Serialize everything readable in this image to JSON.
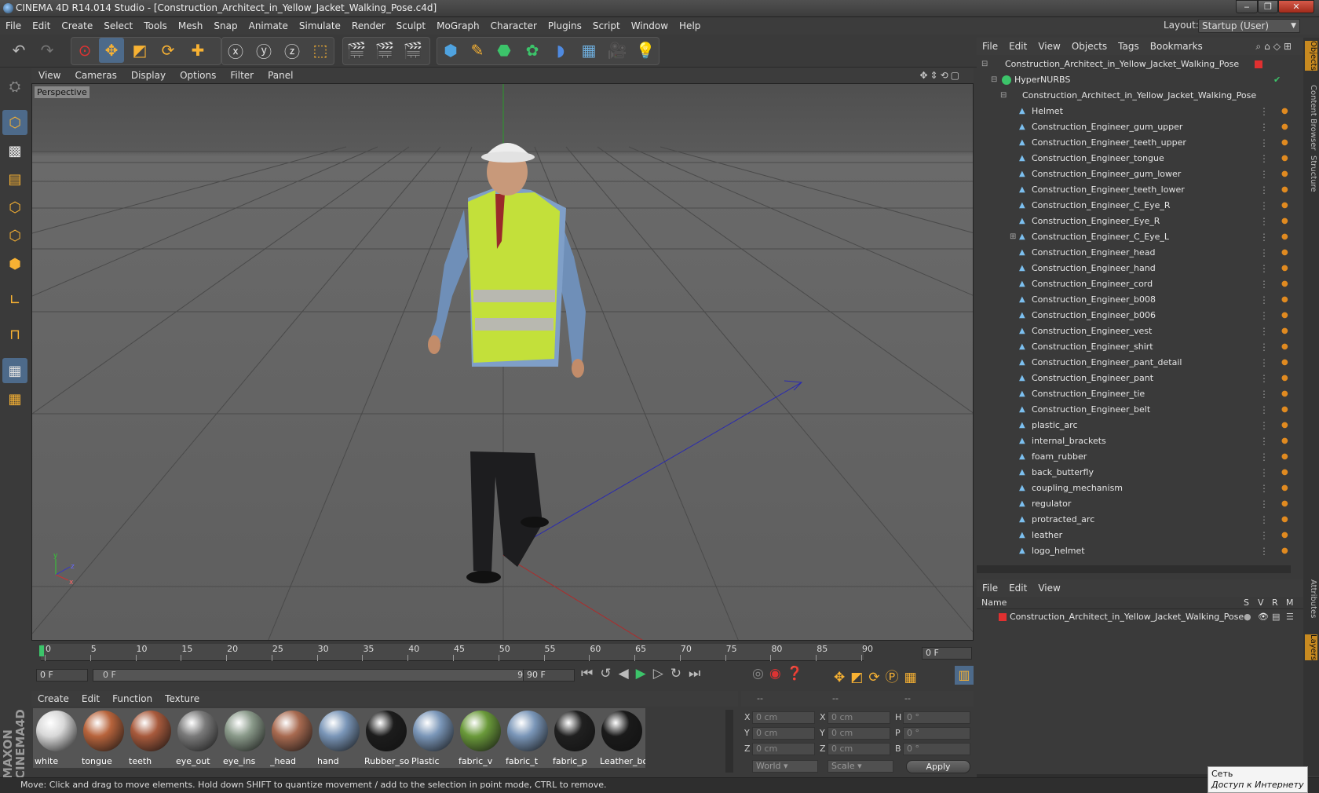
{
  "window": {
    "title": "CINEMA 4D R14.014 Studio - [Construction_Architect_in_Yellow_Jacket_Walking_Pose.c4d]",
    "controls": [
      "‒",
      "❐",
      "✕"
    ]
  },
  "menubar": {
    "items": [
      "File",
      "Edit",
      "Create",
      "Select",
      "Tools",
      "Mesh",
      "Snap",
      "Animate",
      "Simulate",
      "Render",
      "Sculpt",
      "MoGraph",
      "Character",
      "Plugins",
      "Script",
      "Window",
      "Help"
    ]
  },
  "layout": {
    "label": "Layout:",
    "value": "Startup (User)"
  },
  "viewport": {
    "menu": [
      "View",
      "Cameras",
      "Display",
      "Options",
      "Filter",
      "Panel"
    ],
    "label": "Perspective"
  },
  "timeline": {
    "ticks": [
      "0",
      "5",
      "10",
      "15",
      "20",
      "25",
      "30",
      "35",
      "40",
      "45",
      "50",
      "55",
      "60",
      "65",
      "70",
      "75",
      "80",
      "85",
      "90"
    ],
    "current_frame_field": "0 F",
    "start_field": "0 F",
    "range_start": "0 F",
    "range_end": "90 F",
    "end_field": "90 F"
  },
  "material_manager": {
    "menu": [
      "Create",
      "Edit",
      "Function",
      "Texture"
    ],
    "materials": [
      {
        "label": "white",
        "color": "#d8d8d8"
      },
      {
        "label": "tongue",
        "color": "#b8643c"
      },
      {
        "label": "teeth",
        "color": "#a85a3c"
      },
      {
        "label": "eye_out",
        "color": "#7a7a7a"
      },
      {
        "label": "eye_ins",
        "color": "#8a9a8a"
      },
      {
        "label": "_head",
        "color": "#a86a50"
      },
      {
        "label": "hand",
        "color": "#7a96b8"
      },
      {
        "label": "Rubber_so",
        "color": "#1c1c1c"
      },
      {
        "label": "Plastic",
        "color": "#7a96b8"
      },
      {
        "label": "fabric_v",
        "color": "#6a9a3a"
      },
      {
        "label": "fabric_t",
        "color": "#7a96b8"
      },
      {
        "label": "fabric_p",
        "color": "#202020"
      },
      {
        "label": "Leather_bo",
        "color": "#1a1a1a"
      }
    ]
  },
  "coordinates": {
    "headers": [
      "--",
      "--",
      "--"
    ],
    "rows": [
      {
        "a": "X",
        "av": "0 cm",
        "b": "X",
        "bv": "0 cm",
        "c": "H",
        "cv": "0 °"
      },
      {
        "a": "Y",
        "av": "0 cm",
        "b": "Y",
        "bv": "0 cm",
        "c": "P",
        "cv": "0 °"
      },
      {
        "a": "Z",
        "av": "0 cm",
        "b": "Z",
        "bv": "0 cm",
        "c": "B",
        "cv": "0 °"
      }
    ],
    "mode": "World",
    "scale": "Scale",
    "apply": "Apply"
  },
  "object_manager": {
    "menu": [
      "File",
      "Edit",
      "View",
      "Objects",
      "Tags",
      "Bookmarks"
    ],
    "root": "Construction_Architect_in_Yellow_Jacket_Walking_Pose",
    "hypernurbs": "HyperNURBS",
    "group": "Construction_Architect_in_Yellow_Jacket_Walking_Pose",
    "children": [
      "Helmet",
      "Construction_Engineer_gum_upper",
      "Construction_Engineer_teeth_upper",
      "Construction_Engineer_tongue",
      "Construction_Engineer_gum_lower",
      "Construction_Engineer_teeth_lower",
      "Construction_Engineer_C_Eye_R",
      "Construction_Engineer_Eye_R",
      "Construction_Engineer_C_Eye_L",
      "Construction_Engineer_head",
      "Construction_Engineer_hand",
      "Construction_Engineer_cord",
      "Construction_Engineer_b008",
      "Construction_Engineer_b006",
      "Construction_Engineer_vest",
      "Construction_Engineer_shirt",
      "Construction_Engineer_pant_detail",
      "Construction_Engineer_pant",
      "Construction_Engineer_tie",
      "Construction_Engineer_belt",
      "plastic_arc",
      "internal_brackets",
      "foam_rubber",
      "back_butterfly",
      "coupling_mechanism",
      "regulator",
      "protracted_arc",
      "leather",
      "logo_helmet"
    ]
  },
  "layer_manager": {
    "menu": [
      "File",
      "Edit",
      "View"
    ],
    "columns": {
      "name": "Name",
      "s": "S",
      "v": "V",
      "r": "R",
      "m": "M"
    },
    "layers": [
      "Construction_Architect_in_Yellow_Jacket_Walking_Pose"
    ]
  },
  "side_tabs": [
    "Objects",
    "Content Browser",
    "Structure",
    "Attributes",
    "Layers"
  ],
  "brand": "MAXON CINEMA 4D",
  "status": "Move: Click and drag to move elements. Hold down SHIFT to quantize movement / add to the selection in point mode, CTRL to remove.",
  "tooltip": {
    "line1": "Сеть",
    "line2": "Доступ к Интернету"
  }
}
